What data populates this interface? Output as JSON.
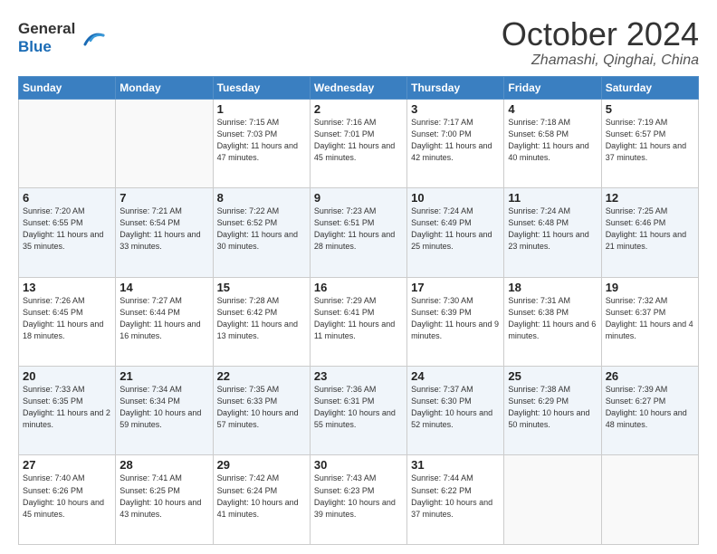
{
  "header": {
    "logo_line1": "General",
    "logo_line2": "Blue",
    "month": "October 2024",
    "location": "Zhamashi, Qinghai, China"
  },
  "weekdays": [
    "Sunday",
    "Monday",
    "Tuesday",
    "Wednesday",
    "Thursday",
    "Friday",
    "Saturday"
  ],
  "weeks": [
    [
      {
        "day": "",
        "info": ""
      },
      {
        "day": "",
        "info": ""
      },
      {
        "day": "1",
        "info": "Sunrise: 7:15 AM\nSunset: 7:03 PM\nDaylight: 11 hours and 47 minutes."
      },
      {
        "day": "2",
        "info": "Sunrise: 7:16 AM\nSunset: 7:01 PM\nDaylight: 11 hours and 45 minutes."
      },
      {
        "day": "3",
        "info": "Sunrise: 7:17 AM\nSunset: 7:00 PM\nDaylight: 11 hours and 42 minutes."
      },
      {
        "day": "4",
        "info": "Sunrise: 7:18 AM\nSunset: 6:58 PM\nDaylight: 11 hours and 40 minutes."
      },
      {
        "day": "5",
        "info": "Sunrise: 7:19 AM\nSunset: 6:57 PM\nDaylight: 11 hours and 37 minutes."
      }
    ],
    [
      {
        "day": "6",
        "info": "Sunrise: 7:20 AM\nSunset: 6:55 PM\nDaylight: 11 hours and 35 minutes."
      },
      {
        "day": "7",
        "info": "Sunrise: 7:21 AM\nSunset: 6:54 PM\nDaylight: 11 hours and 33 minutes."
      },
      {
        "day": "8",
        "info": "Sunrise: 7:22 AM\nSunset: 6:52 PM\nDaylight: 11 hours and 30 minutes."
      },
      {
        "day": "9",
        "info": "Sunrise: 7:23 AM\nSunset: 6:51 PM\nDaylight: 11 hours and 28 minutes."
      },
      {
        "day": "10",
        "info": "Sunrise: 7:24 AM\nSunset: 6:49 PM\nDaylight: 11 hours and 25 minutes."
      },
      {
        "day": "11",
        "info": "Sunrise: 7:24 AM\nSunset: 6:48 PM\nDaylight: 11 hours and 23 minutes."
      },
      {
        "day": "12",
        "info": "Sunrise: 7:25 AM\nSunset: 6:46 PM\nDaylight: 11 hours and 21 minutes."
      }
    ],
    [
      {
        "day": "13",
        "info": "Sunrise: 7:26 AM\nSunset: 6:45 PM\nDaylight: 11 hours and 18 minutes."
      },
      {
        "day": "14",
        "info": "Sunrise: 7:27 AM\nSunset: 6:44 PM\nDaylight: 11 hours and 16 minutes."
      },
      {
        "day": "15",
        "info": "Sunrise: 7:28 AM\nSunset: 6:42 PM\nDaylight: 11 hours and 13 minutes."
      },
      {
        "day": "16",
        "info": "Sunrise: 7:29 AM\nSunset: 6:41 PM\nDaylight: 11 hours and 11 minutes."
      },
      {
        "day": "17",
        "info": "Sunrise: 7:30 AM\nSunset: 6:39 PM\nDaylight: 11 hours and 9 minutes."
      },
      {
        "day": "18",
        "info": "Sunrise: 7:31 AM\nSunset: 6:38 PM\nDaylight: 11 hours and 6 minutes."
      },
      {
        "day": "19",
        "info": "Sunrise: 7:32 AM\nSunset: 6:37 PM\nDaylight: 11 hours and 4 minutes."
      }
    ],
    [
      {
        "day": "20",
        "info": "Sunrise: 7:33 AM\nSunset: 6:35 PM\nDaylight: 11 hours and 2 minutes."
      },
      {
        "day": "21",
        "info": "Sunrise: 7:34 AM\nSunset: 6:34 PM\nDaylight: 10 hours and 59 minutes."
      },
      {
        "day": "22",
        "info": "Sunrise: 7:35 AM\nSunset: 6:33 PM\nDaylight: 10 hours and 57 minutes."
      },
      {
        "day": "23",
        "info": "Sunrise: 7:36 AM\nSunset: 6:31 PM\nDaylight: 10 hours and 55 minutes."
      },
      {
        "day": "24",
        "info": "Sunrise: 7:37 AM\nSunset: 6:30 PM\nDaylight: 10 hours and 52 minutes."
      },
      {
        "day": "25",
        "info": "Sunrise: 7:38 AM\nSunset: 6:29 PM\nDaylight: 10 hours and 50 minutes."
      },
      {
        "day": "26",
        "info": "Sunrise: 7:39 AM\nSunset: 6:27 PM\nDaylight: 10 hours and 48 minutes."
      }
    ],
    [
      {
        "day": "27",
        "info": "Sunrise: 7:40 AM\nSunset: 6:26 PM\nDaylight: 10 hours and 45 minutes."
      },
      {
        "day": "28",
        "info": "Sunrise: 7:41 AM\nSunset: 6:25 PM\nDaylight: 10 hours and 43 minutes."
      },
      {
        "day": "29",
        "info": "Sunrise: 7:42 AM\nSunset: 6:24 PM\nDaylight: 10 hours and 41 minutes."
      },
      {
        "day": "30",
        "info": "Sunrise: 7:43 AM\nSunset: 6:23 PM\nDaylight: 10 hours and 39 minutes."
      },
      {
        "day": "31",
        "info": "Sunrise: 7:44 AM\nSunset: 6:22 PM\nDaylight: 10 hours and 37 minutes."
      },
      {
        "day": "",
        "info": ""
      },
      {
        "day": "",
        "info": ""
      }
    ]
  ]
}
